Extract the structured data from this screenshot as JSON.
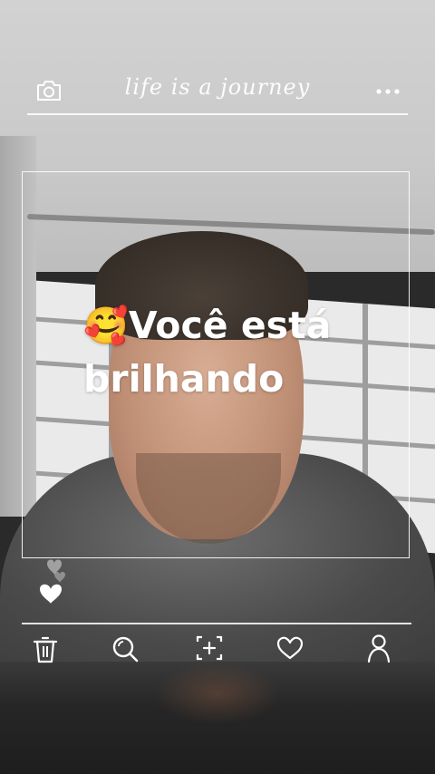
{
  "header": {
    "title": "life is a journey",
    "camera_icon": "camera-icon",
    "more_icon": "more-dots-icon"
  },
  "caption": {
    "emoji": "🥰",
    "line1": "Você está",
    "line2": "brilhando"
  },
  "side": {
    "hearts_icon": "heart-icon"
  },
  "bottom_nav": {
    "items": [
      {
        "icon": "trash-icon"
      },
      {
        "icon": "search-icon"
      },
      {
        "icon": "add-frame-icon"
      },
      {
        "icon": "heart-outline-icon"
      },
      {
        "icon": "profile-icon"
      }
    ]
  },
  "colors": {
    "overlay": "#ffffff",
    "heart": "#ffffff"
  }
}
